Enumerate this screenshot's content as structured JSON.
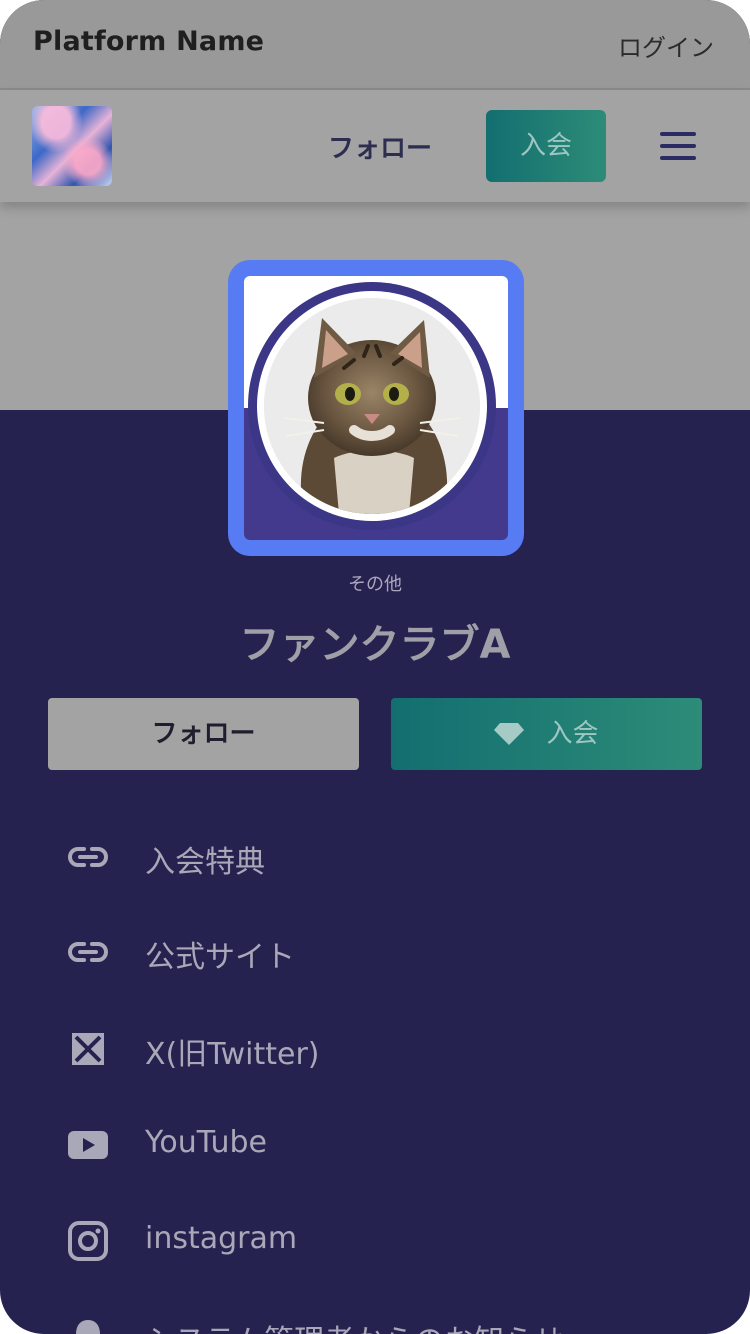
{
  "platform": {
    "name": "Platform Name",
    "login": "ログイン"
  },
  "header": {
    "follow": "フォロー",
    "join": "入会",
    "logo": "club-logo",
    "menu_icon": "hamburger-icon"
  },
  "profile": {
    "category": "その他",
    "name": "ファンクラブA",
    "follow_button": "フォロー",
    "join_button": "入会",
    "join_icon": "diamond-icon"
  },
  "links": [
    {
      "label": "入会特典",
      "icon": "link-icon"
    },
    {
      "label": "公式サイト",
      "icon": "link-icon"
    },
    {
      "label": "X(旧Twitter)",
      "icon": "x-icon"
    },
    {
      "label": "YouTube",
      "icon": "youtube-icon"
    },
    {
      "label": "instagram",
      "icon": "instagram-icon"
    },
    {
      "label": "システム管理者からのお知らせ",
      "icon": "bell-icon"
    }
  ],
  "colors": {
    "page_bg": "#26224f",
    "accent_blue": "#577bf3",
    "join_gradient_start": "#136e70",
    "join_gradient_end": "#2d8c78"
  }
}
